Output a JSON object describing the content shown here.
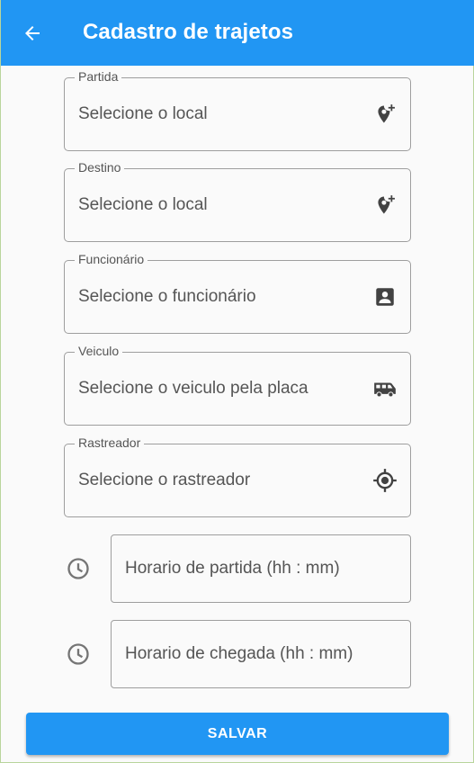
{
  "appbar": {
    "title": "Cadastro de trajetos",
    "back_icon": "arrow-back-icon",
    "color": "#2196f3"
  },
  "fields": [
    {
      "label": "Partida",
      "hint": "Selecione o local",
      "icon": "add-location-icon"
    },
    {
      "label": "Destino",
      "hint": "Selecione o local",
      "icon": "add-location-icon"
    },
    {
      "label": "Funcionário",
      "hint": "Selecione o funcionário",
      "icon": "contact-card-icon"
    },
    {
      "label": "Veiculo",
      "hint": "Selecione o veiculo pela placa",
      "icon": "van-icon"
    },
    {
      "label": "Rastreador",
      "hint": "Selecione o rastreador",
      "icon": "gps-fixed-icon"
    }
  ],
  "times": [
    {
      "placeholder": "Horario de partida (hh : mm)",
      "icon": "clock-icon"
    },
    {
      "placeholder": "Horario de chegada (hh : mm)",
      "icon": "clock-icon"
    }
  ],
  "save_button": {
    "label": "SALVAR"
  }
}
